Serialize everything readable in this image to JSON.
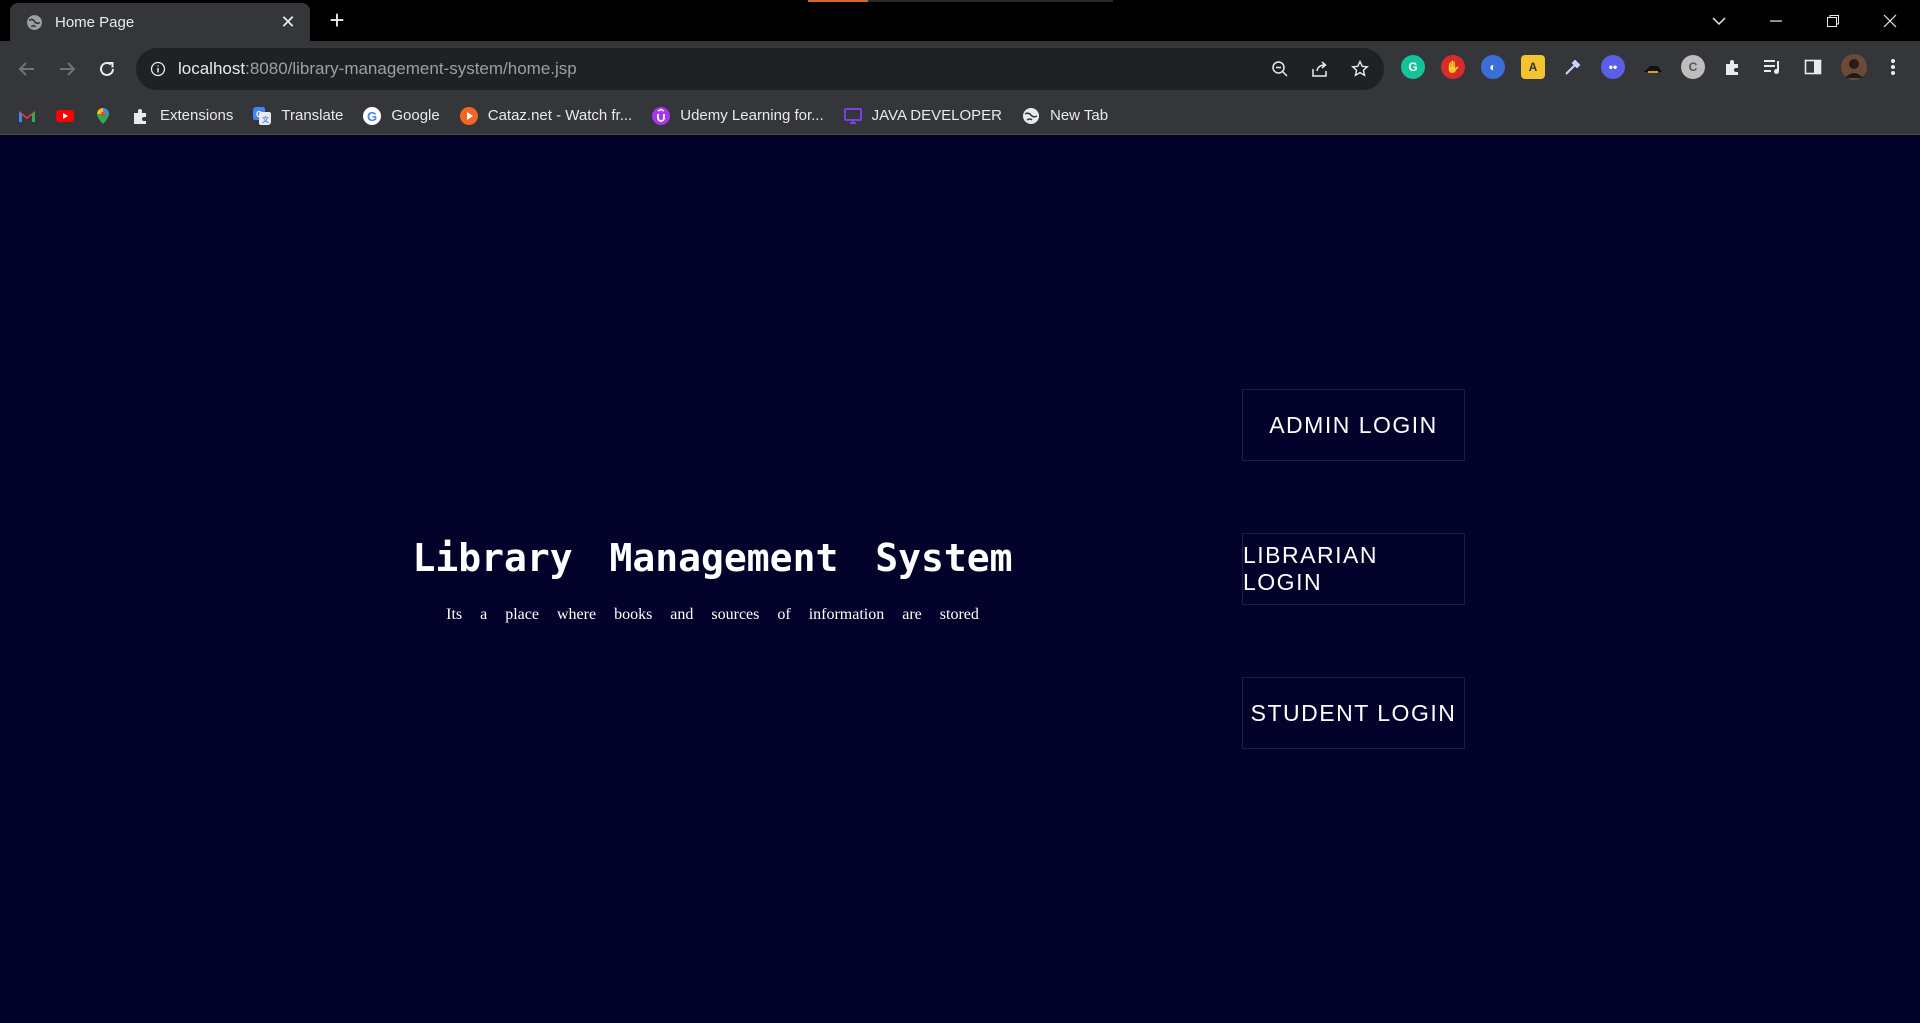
{
  "browser": {
    "tab_title": "Home Page",
    "url_host": "localhost",
    "url_path": ":8080/library-management-system/home.jsp"
  },
  "bookmarks": [
    {
      "label": "",
      "icon": "gmail-icon",
      "color": "#ea4335"
    },
    {
      "label": "",
      "icon": "youtube-icon",
      "color": "#ff0000"
    },
    {
      "label": "",
      "icon": "maps-icon",
      "color": "#34a853"
    },
    {
      "label": "Extensions",
      "icon": "puzzle-icon",
      "color": "#e8eaed"
    },
    {
      "label": "Translate",
      "icon": "translate-icon",
      "color": "#4285f4"
    },
    {
      "label": "Google",
      "icon": "google-icon",
      "color": "#ffffff"
    },
    {
      "label": "Cataz.net - Watch fr...",
      "icon": "play-icon",
      "color": "#f26522"
    },
    {
      "label": "Udemy Learning for...",
      "icon": "udemy-icon",
      "color": "#a435f0"
    },
    {
      "label": "JAVA DEVELOPER",
      "icon": "monitor-icon",
      "color": "#7b3fe4"
    },
    {
      "label": "New Tab",
      "icon": "globe-icon",
      "color": "#e8eaed"
    }
  ],
  "page": {
    "heading": "Library Management System",
    "subtitle": "Its a place where books and sources of information are stored",
    "buttons": {
      "admin": "ADMIN LOGIN",
      "librarian": "LIBRARIAN LOGIN",
      "student": "STUDENT LOGIN"
    }
  },
  "colors": {
    "page_background": "#03022b",
    "button_border": "#1b1a5a",
    "text": "#ffffff"
  }
}
